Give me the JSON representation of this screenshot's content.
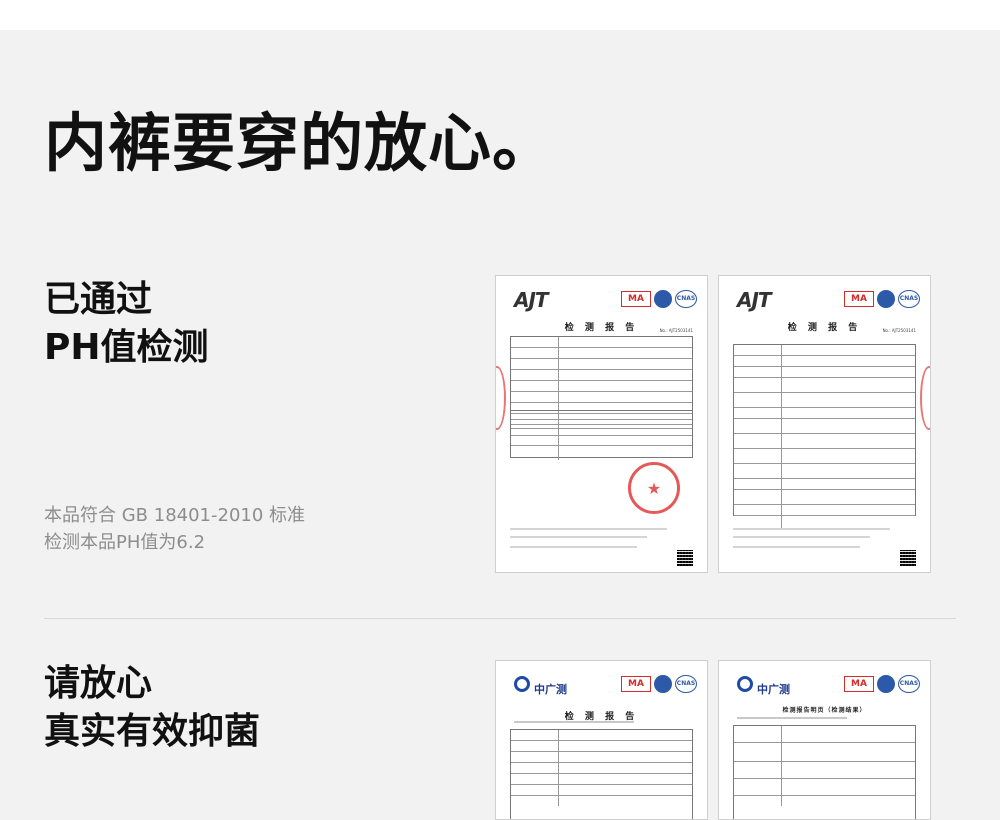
{
  "headline": "内裤要穿的放心。",
  "section1": {
    "title_line1": "已通过",
    "title_line2": "PH值检测",
    "note_line1": "本品符合 GB 18401-2010 标准",
    "note_line2": "检测本品PH值为6.2"
  },
  "section2": {
    "title_line1": "请放心",
    "title_line2": "真实有效抑菌"
  },
  "certs": {
    "ajt_logo": "AJT",
    "gc_logo": "中广测",
    "ma_badge": "MA",
    "cnas_badge": "CNAS",
    "report_title": "检 测 报 告",
    "report_no": "No.: AJT2503141",
    "detail_title": "检测报告明页（检测结果）"
  },
  "colors": {
    "background": "#f2f2f2",
    "stamp_red": "#e03c3c",
    "badge_blue": "#2d5aa8",
    "note_gray": "#8d8d8d"
  }
}
